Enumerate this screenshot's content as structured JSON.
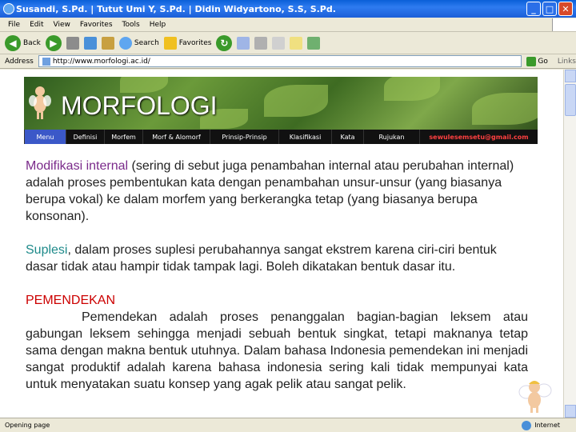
{
  "window": {
    "title": "Susandi, S.Pd. | Tutut Umi Y, S.Pd. | Didin Widyartono, S.S, S.Pd.",
    "buttons": [
      "_",
      "□",
      "✕"
    ]
  },
  "menu": [
    "File",
    "Edit",
    "View",
    "Favorites",
    "Tools",
    "Help"
  ],
  "toolbar": {
    "back_label": "Back",
    "search_label": "Search",
    "favorites_label": "Favorites"
  },
  "address": {
    "label": "Address",
    "value": "http://www.morfologi.ac.id/",
    "go_label": "Go",
    "links_label": "Links"
  },
  "banner": {
    "title": "MORFOLOGI"
  },
  "nav": {
    "items": [
      "Menu",
      "Definisi",
      "Morfem",
      "Morf & Alomorf",
      "Prinsip-Prinsip",
      "Klasifikasi",
      "Kata",
      "Rujukan"
    ],
    "email": "sewulesemsetu@gmail.com",
    "active_color": "#3B58C8"
  },
  "content": {
    "p1_term": "Modifikasi internal",
    "p1_text": " (sering di sebut juga penambahan internal atau perubahan internal) adalah proses pembentukan kata dengan penambahan unsur-unsur (yang biasanya berupa vokal) ke dalam morfem yang berkerangka tetap (yang biasanya berupa konsonan).",
    "p2_term": "Suplesi",
    "p2_text": ", dalam proses suplesi perubahannya sangat ekstrem karena ciri-ciri bentuk dasar tidak atau hampir tidak tampak lagi. Boleh dikatakan bentuk dasar itu.",
    "p3_heading": "PEMENDEKAN",
    "p3_text": "Pemendekan adalah proses penanggalan bagian-bagian leksem atau gabungan leksem sehingga menjadi sebuah bentuk singkat, tetapi maknanya tetap sama dengan makna bentuk utuhnya. Dalam bahasa Indonesia pemendekan ini menjadi sangat produktif adalah karena bahasa indonesia sering kali tidak mempunyai kata untuk menyatakan suatu konsep yang agak pelik atau sangat pelik."
  },
  "status": {
    "text": "Opening page",
    "zone": "Internet"
  }
}
